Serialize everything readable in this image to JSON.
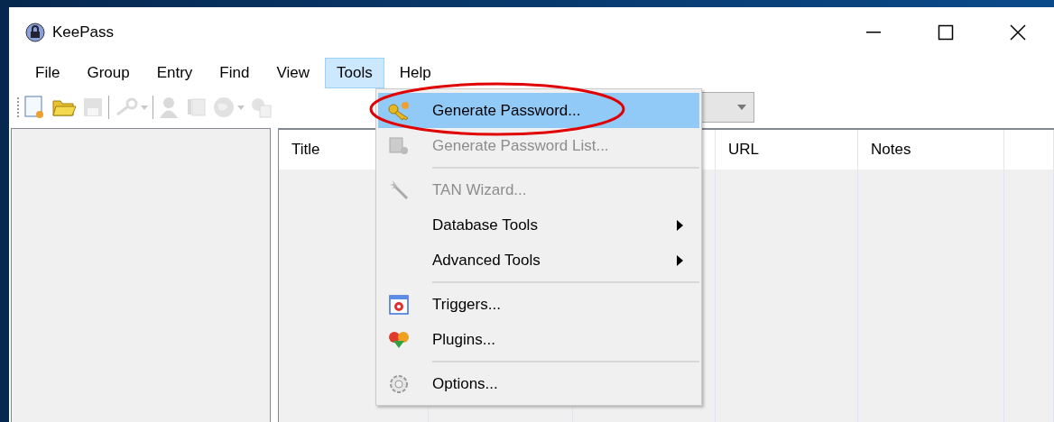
{
  "window": {
    "title": "KeePass"
  },
  "menu_bar": [
    {
      "label": "File",
      "selected": false
    },
    {
      "label": "Group",
      "selected": false
    },
    {
      "label": "Entry",
      "selected": false
    },
    {
      "label": "Find",
      "selected": false
    },
    {
      "label": "View",
      "selected": false
    },
    {
      "label": "Tools",
      "selected": true
    },
    {
      "label": "Help",
      "selected": false
    }
  ],
  "toolbar": [
    {
      "disabled": false,
      "dropdown": false
    },
    {
      "disabled": false,
      "dropdown": false
    },
    {
      "disabled": true,
      "dropdown": false
    },
    {
      "kind": "separator"
    },
    {
      "disabled": true,
      "dropdown": true
    },
    {
      "kind": "separator"
    },
    {
      "disabled": true,
      "dropdown": false
    },
    {
      "disabled": true,
      "dropdown": false
    },
    {
      "disabled": true,
      "dropdown": true
    },
    {
      "disabled": true,
      "dropdown": false
    }
  ],
  "entry_list": {
    "columns": [
      {
        "label": "Title"
      },
      {
        "label": "URL"
      },
      {
        "label": "Notes"
      }
    ]
  },
  "tools_menu": [
    {
      "kind": "item",
      "label": "Generate Password...",
      "disabled": false,
      "selected": true,
      "submenu": false
    },
    {
      "kind": "item",
      "label": "Generate Password List...",
      "disabled": true,
      "selected": false,
      "submenu": false
    },
    {
      "kind": "separator"
    },
    {
      "kind": "item",
      "label": "TAN Wizard...",
      "disabled": true,
      "selected": false,
      "submenu": false
    },
    {
      "kind": "item",
      "label": "Database Tools",
      "disabled": false,
      "selected": false,
      "submenu": true
    },
    {
      "kind": "item",
      "label": "Advanced Tools",
      "disabled": false,
      "selected": false,
      "submenu": true
    },
    {
      "kind": "separator"
    },
    {
      "kind": "item",
      "label": "Triggers...",
      "disabled": false,
      "selected": false,
      "submenu": false
    },
    {
      "kind": "item",
      "label": "Plugins...",
      "disabled": false,
      "selected": false,
      "submenu": false
    },
    {
      "kind": "separator"
    },
    {
      "kind": "item",
      "label": "Options...",
      "disabled": false,
      "selected": false,
      "submenu": false
    }
  ]
}
